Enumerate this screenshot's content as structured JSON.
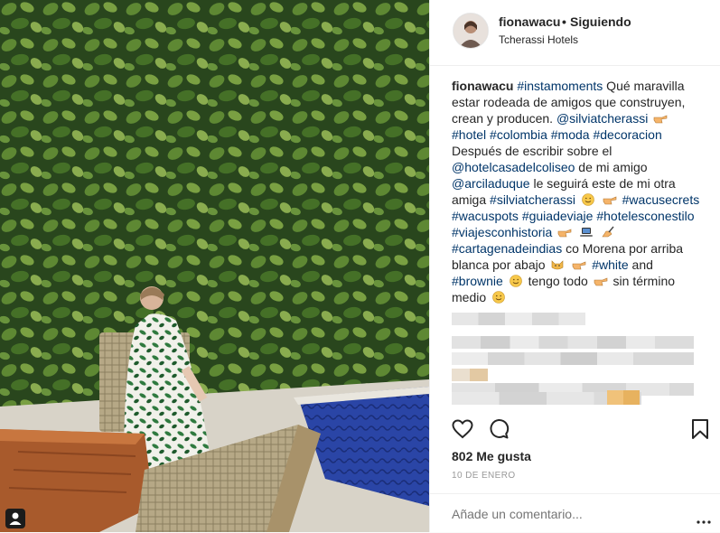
{
  "post": {
    "username": "fionawacu",
    "separator": "•",
    "follow_status": "Siguiendo",
    "location": "Tcherassi Hotels"
  },
  "caption": {
    "author": "fionawacu",
    "p1": "#instamoments",
    "t1": " Qué maravilla estar rodeada de amigos que construyen, crean y producen. ",
    "p2": "@silviatcherassi",
    "p3": "#hotel",
    "p4": "#colombia",
    "p5": "#moda",
    "p6": "#decoracion",
    "t2": "Después de escribir sobre el ",
    "p7": "@hotelcasadelcoliseo",
    "t3": " de mi amigo ",
    "p8": "@arciladuque",
    "t4": " le seguirá este de mi otra amiga ",
    "p9": "#silviatcherassi",
    "p10": "#wacusecrets",
    "p11": "#wacuspots",
    "p12": "#guiadeviaje",
    "p13": "#hotelesconestilo",
    "p14": "#viajesconhistoria",
    "p15": "#cartagenadeindias",
    "t5": " co Morena por arriba blanca por abajo ",
    "p16": "#white",
    "t6": " and ",
    "p17": "#brownie",
    "t7": " tengo todo ",
    "t8": " sin término medio "
  },
  "icons": {
    "heart": "heart-icon",
    "comment": "comment-bubble-icon",
    "bookmark": "bookmark-icon",
    "more": "more-options-icon",
    "tag": "user-tag-icon"
  },
  "stats": {
    "likes": "802 Me gusta",
    "date": "10 DE ENERO"
  },
  "comment_box": {
    "placeholder": "Añade un comentario..."
  },
  "colors": {
    "link": "#003569",
    "text": "#262626",
    "muted": "#999999",
    "border": "#efefef"
  }
}
